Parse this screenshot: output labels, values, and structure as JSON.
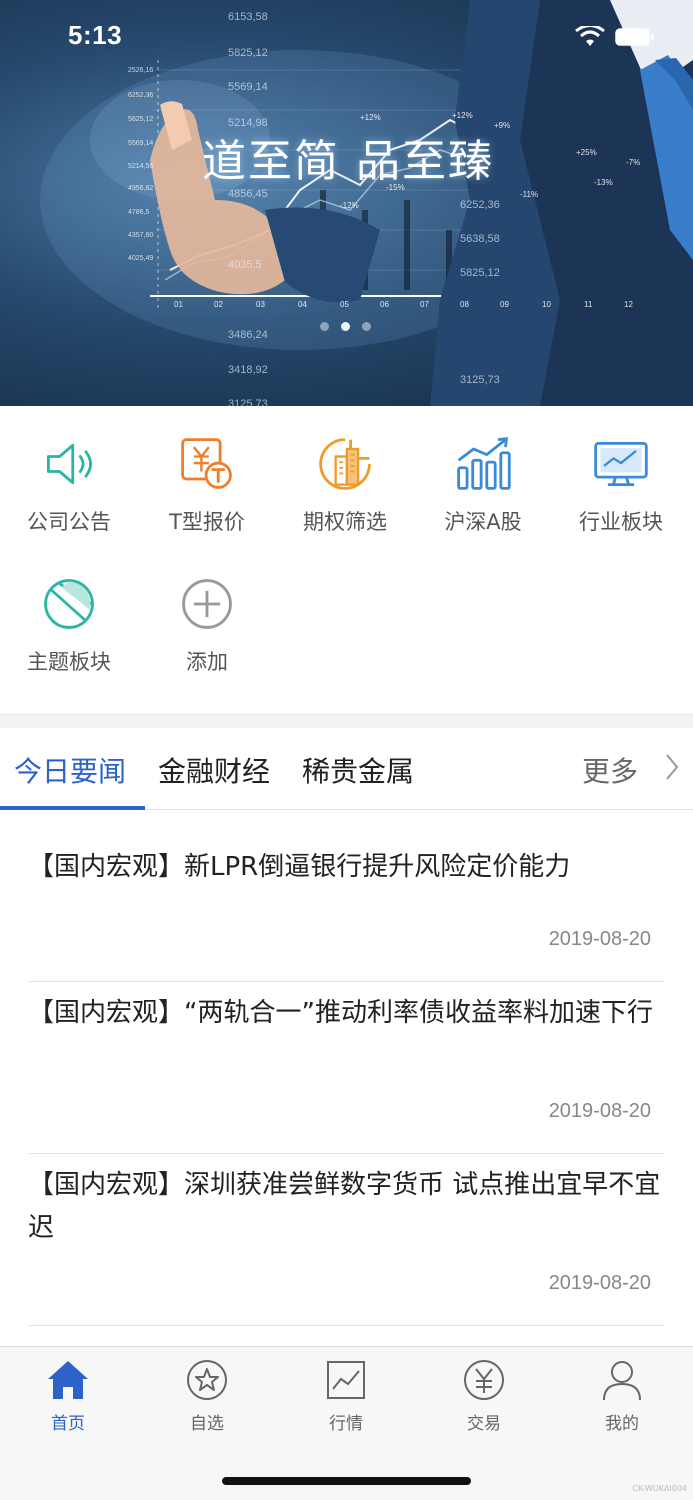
{
  "status_bar": {
    "time": "5:13"
  },
  "banner": {
    "slogan": "道至简 品至臻",
    "numbers": [
      "6153,58",
      "5825,12",
      "5569,14",
      "5214,98",
      "4856,45",
      "4035,5",
      "3486,24",
      "3418,92",
      "3125,73",
      "6252,36",
      "5825,12",
      "3125,73"
    ],
    "axis_values": [
      "2526,16",
      "6252,36",
      "5825,12",
      "5569,14",
      "5214,56",
      "4956,82",
      "4786,5",
      "4357,60",
      "4025,49"
    ],
    "x_ticks": [
      "01",
      "02",
      "03",
      "04",
      "05",
      "06",
      "07",
      "08",
      "09",
      "10",
      "11",
      "12"
    ],
    "percentages": [
      "+12%",
      "+9%",
      "-11%",
      "-12%",
      "-15%",
      "+25%",
      "-13%",
      "-7%",
      "-11%"
    ],
    "page_count": 3,
    "active_page": 2
  },
  "shortcuts": [
    {
      "label": "公司公告",
      "icon": "speaker-icon",
      "color": "#2bb5a3"
    },
    {
      "label": "T型报价",
      "icon": "yen-t-icon",
      "color": "#ef7d2a"
    },
    {
      "label": "期权筛选",
      "icon": "building-chart-icon",
      "color": "#ef9b2a"
    },
    {
      "label": "沪深A股",
      "icon": "bar-trend-icon",
      "color": "#3b8ad8"
    },
    {
      "label": "行业板块",
      "icon": "monitor-chart-icon",
      "color": "#3b8ad8"
    },
    {
      "label": "主题板块",
      "icon": "pie-icon",
      "color": "#2bb5a3"
    },
    {
      "label": "添加",
      "icon": "add-circle-icon",
      "color": "#999999"
    }
  ],
  "tabs": {
    "items": [
      "今日要闻",
      "金融财经",
      "稀贵金属"
    ],
    "active": 0,
    "more": "更多",
    "accent": "#2d63c8"
  },
  "news": [
    {
      "title": "【国内宏观】新LPR倒逼银行提升风险定价能力",
      "date": "2019-08-20"
    },
    {
      "title": "【国内宏观】“两轨合一”推动利率债收益率料加速下行",
      "date": "2019-08-20"
    },
    {
      "title": "【国内宏观】深圳获准尝鲜数字货币 试点推出宜早不宜迟",
      "date": "2019-08-20"
    }
  ],
  "bottom_nav": [
    {
      "label": "首页",
      "icon": "home-icon",
      "active": true
    },
    {
      "label": "自选",
      "icon": "star-circle-icon",
      "active": false
    },
    {
      "label": "行情",
      "icon": "chart-square-icon",
      "active": false
    },
    {
      "label": "交易",
      "icon": "yen-circle-icon",
      "active": false
    },
    {
      "label": "我的",
      "icon": "user-icon",
      "active": false
    }
  ],
  "watermark": "CK-WUKAI004"
}
